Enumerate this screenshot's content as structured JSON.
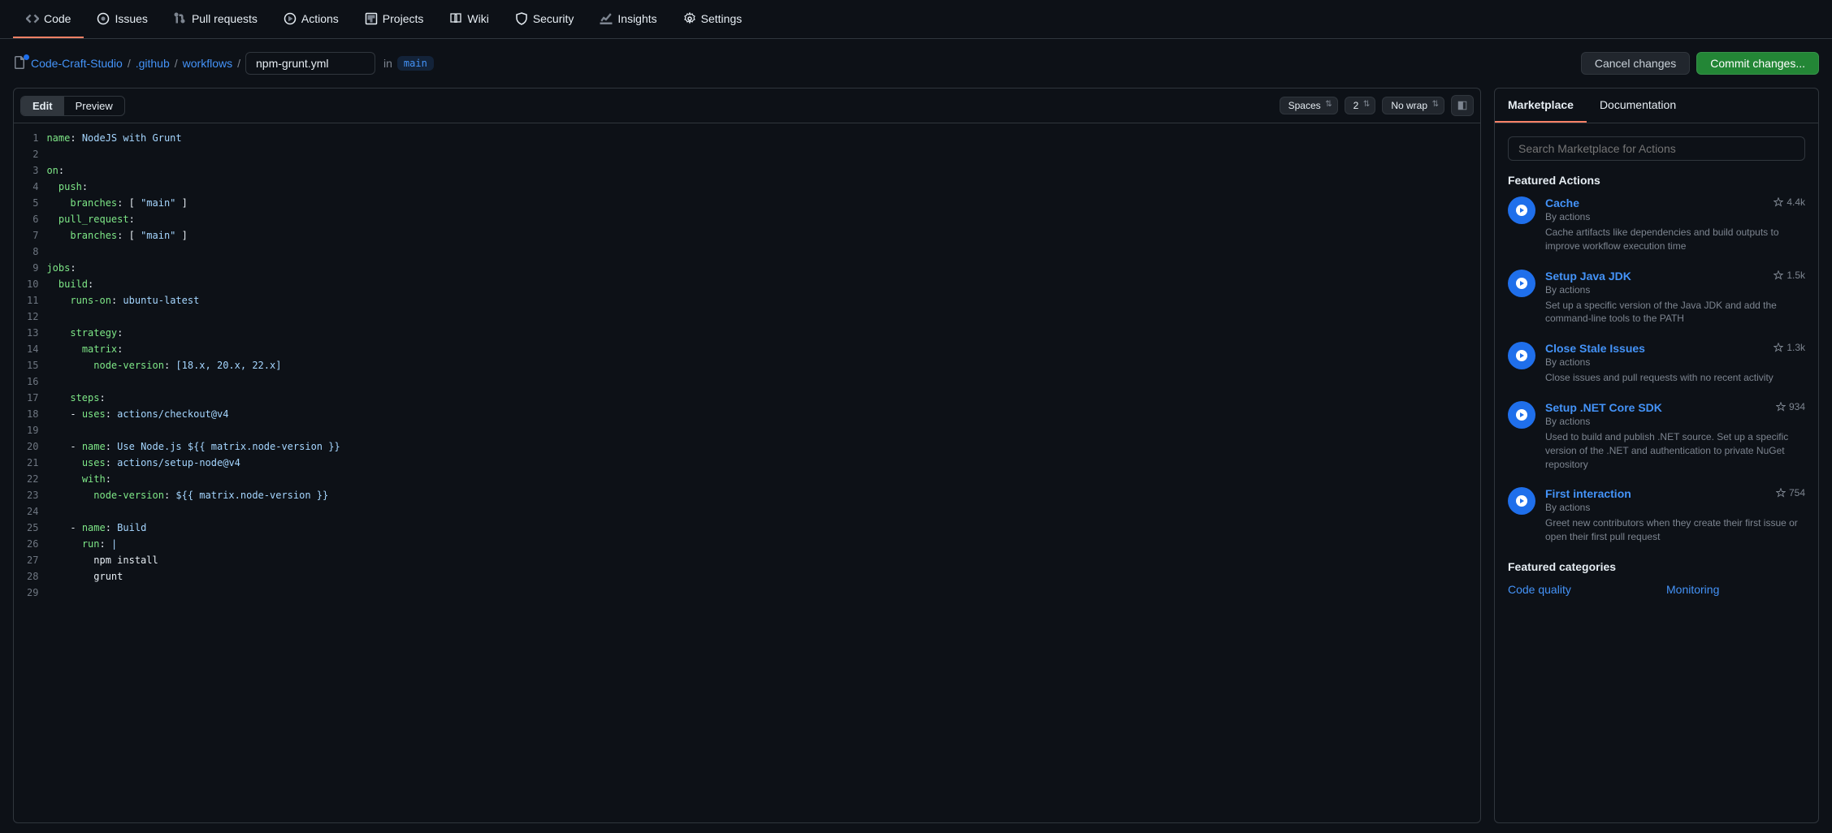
{
  "nav": [
    {
      "icon": "code",
      "label": "Code",
      "active": true
    },
    {
      "icon": "issue",
      "label": "Issues"
    },
    {
      "icon": "pr",
      "label": "Pull requests"
    },
    {
      "icon": "play",
      "label": "Actions"
    },
    {
      "icon": "project",
      "label": "Projects"
    },
    {
      "icon": "book",
      "label": "Wiki"
    },
    {
      "icon": "shield",
      "label": "Security"
    },
    {
      "icon": "graph",
      "label": "Insights"
    },
    {
      "icon": "gear",
      "label": "Settings"
    }
  ],
  "breadcrumb": {
    "repo": "Code-Craft-Studio",
    "path1": ".github",
    "path2": "workflows",
    "filename": "npm-grunt.yml",
    "in": "in",
    "branch": "main"
  },
  "buttons": {
    "cancel": "Cancel changes",
    "commit": "Commit changes..."
  },
  "editorTabs": {
    "edit": "Edit",
    "preview": "Preview"
  },
  "editorSelects": {
    "indent": "Spaces",
    "size": "2",
    "wrap": "No wrap"
  },
  "code": [
    [
      [
        "key",
        "name"
      ],
      [
        "plain",
        ": "
      ],
      [
        "str",
        "NodeJS with Grunt"
      ]
    ],
    [],
    [
      [
        "key",
        "on"
      ],
      [
        "plain",
        ":"
      ]
    ],
    [
      [
        "plain",
        "  "
      ],
      [
        "key",
        "push"
      ],
      [
        "plain",
        ":"
      ]
    ],
    [
      [
        "plain",
        "    "
      ],
      [
        "key",
        "branches"
      ],
      [
        "plain",
        ": [ "
      ],
      [
        "str",
        "\"main\""
      ],
      [
        "plain",
        " ]"
      ]
    ],
    [
      [
        "plain",
        "  "
      ],
      [
        "key",
        "pull_request"
      ],
      [
        "plain",
        ":"
      ]
    ],
    [
      [
        "plain",
        "    "
      ],
      [
        "key",
        "branches"
      ],
      [
        "plain",
        ": [ "
      ],
      [
        "str",
        "\"main\""
      ],
      [
        "plain",
        " ]"
      ]
    ],
    [],
    [
      [
        "key",
        "jobs"
      ],
      [
        "plain",
        ":"
      ]
    ],
    [
      [
        "plain",
        "  "
      ],
      [
        "key",
        "build"
      ],
      [
        "plain",
        ":"
      ]
    ],
    [
      [
        "plain",
        "    "
      ],
      [
        "key",
        "runs-on"
      ],
      [
        "plain",
        ": "
      ],
      [
        "str",
        "ubuntu-latest"
      ]
    ],
    [],
    [
      [
        "plain",
        "    "
      ],
      [
        "key",
        "strategy"
      ],
      [
        "plain",
        ":"
      ]
    ],
    [
      [
        "plain",
        "      "
      ],
      [
        "key",
        "matrix"
      ],
      [
        "plain",
        ":"
      ]
    ],
    [
      [
        "plain",
        "        "
      ],
      [
        "key",
        "node-version"
      ],
      [
        "plain",
        ": "
      ],
      [
        "str",
        "[18.x, 20.x, 22.x]"
      ]
    ],
    [],
    [
      [
        "plain",
        "    "
      ],
      [
        "key",
        "steps"
      ],
      [
        "plain",
        ":"
      ]
    ],
    [
      [
        "plain",
        "    - "
      ],
      [
        "key",
        "uses"
      ],
      [
        "plain",
        ": "
      ],
      [
        "str",
        "actions/checkout@v4"
      ]
    ],
    [],
    [
      [
        "plain",
        "    - "
      ],
      [
        "key",
        "name"
      ],
      [
        "plain",
        ": "
      ],
      [
        "str",
        "Use Node.js ${{ matrix.node-version }}"
      ]
    ],
    [
      [
        "plain",
        "      "
      ],
      [
        "key",
        "uses"
      ],
      [
        "plain",
        ": "
      ],
      [
        "str",
        "actions/setup-node@v4"
      ]
    ],
    [
      [
        "plain",
        "      "
      ],
      [
        "key",
        "with"
      ],
      [
        "plain",
        ":"
      ]
    ],
    [
      [
        "plain",
        "        "
      ],
      [
        "key",
        "node-version"
      ],
      [
        "plain",
        ": "
      ],
      [
        "str",
        "${{ matrix.node-version }}"
      ]
    ],
    [],
    [
      [
        "plain",
        "    - "
      ],
      [
        "key",
        "name"
      ],
      [
        "plain",
        ": "
      ],
      [
        "str",
        "Build"
      ]
    ],
    [
      [
        "plain",
        "      "
      ],
      [
        "key",
        "run"
      ],
      [
        "plain",
        ": "
      ],
      [
        "str",
        "|"
      ]
    ],
    [
      [
        "plain",
        "        npm install"
      ]
    ],
    [
      [
        "plain",
        "        grunt"
      ]
    ],
    []
  ],
  "sidebar": {
    "tabs": {
      "marketplace": "Marketplace",
      "docs": "Documentation"
    },
    "searchPlaceholder": "Search Marketplace for Actions",
    "featuredHead": "Featured Actions",
    "actions": [
      {
        "title": "Cache",
        "by": "By actions",
        "stars": "4.4k",
        "desc": "Cache artifacts like dependencies and build outputs to improve workflow execution time"
      },
      {
        "title": "Setup Java JDK",
        "by": "By actions",
        "stars": "1.5k",
        "desc": "Set up a specific version of the Java JDK and add the command-line tools to the PATH"
      },
      {
        "title": "Close Stale Issues",
        "by": "By actions",
        "stars": "1.3k",
        "desc": "Close issues and pull requests with no recent activity"
      },
      {
        "title": "Setup .NET Core SDK",
        "by": "By actions",
        "stars": "934",
        "desc": "Used to build and publish .NET source. Set up a specific version of the .NET and authentication to private NuGet repository"
      },
      {
        "title": "First interaction",
        "by": "By actions",
        "stars": "754",
        "desc": "Greet new contributors when they create their first issue or open their first pull request"
      }
    ],
    "catHead": "Featured categories",
    "categories": [
      "Code quality",
      "Monitoring"
    ]
  }
}
